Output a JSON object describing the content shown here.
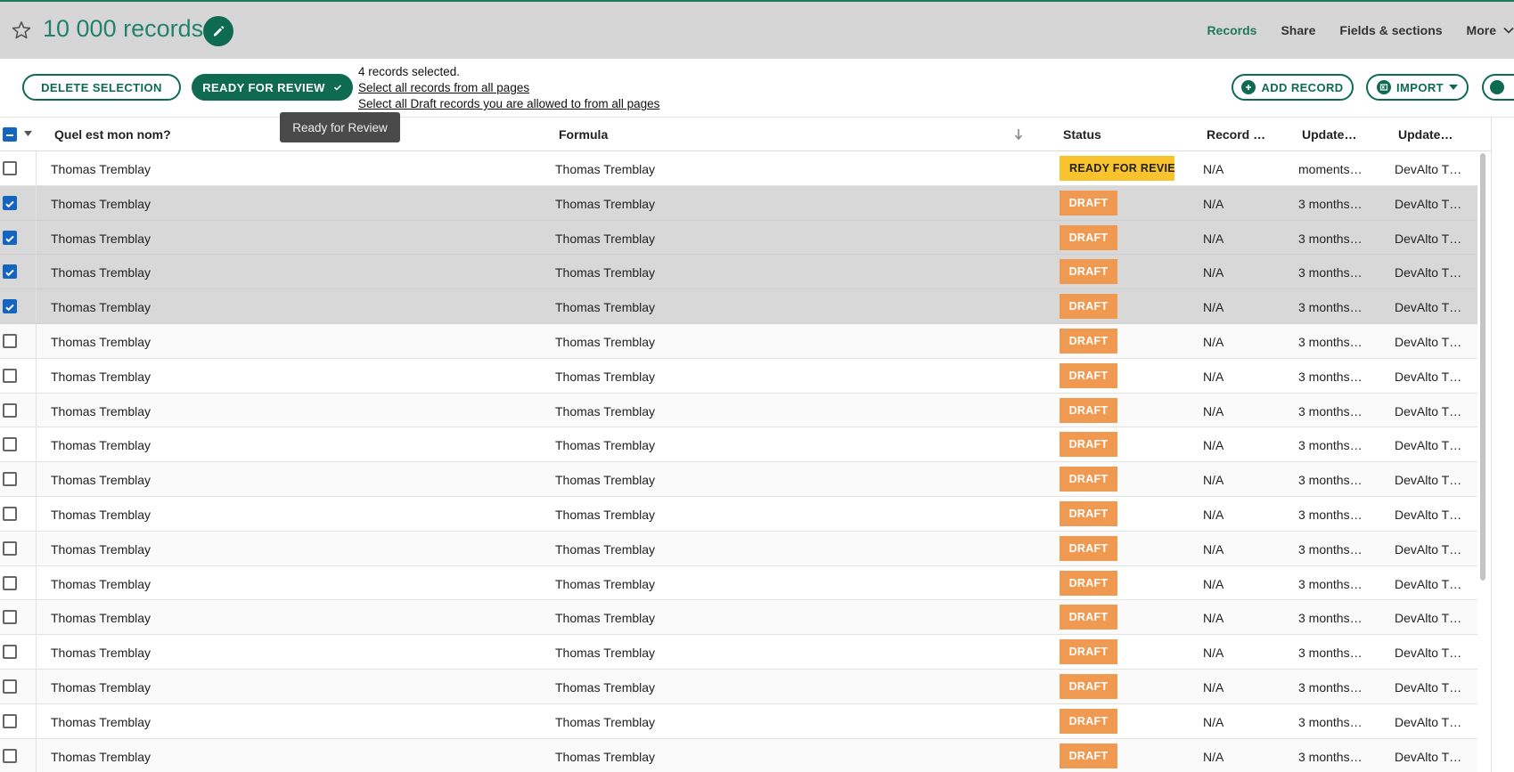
{
  "header": {
    "title": "10 000 records",
    "nav": [
      "Records",
      "Share",
      "Fields & sections",
      "More"
    ],
    "active_nav": "Records"
  },
  "actions": {
    "delete_selection": "DELETE SELECTION",
    "ready_for_review": "READY FOR REVIEW",
    "selection_count": "4 records selected.",
    "select_all_link": "Select all records from all pages",
    "select_draft_link": "Select all Draft records you are allowed to from all pages",
    "add_record": "ADD RECORD",
    "import": "IMPORT",
    "tooltip": "Ready for Review"
  },
  "table": {
    "columns": [
      "Quel est mon nom?",
      "Formula",
      "Status",
      "Record …",
      "Update…",
      "Update…"
    ],
    "rows": [
      {
        "name": "Thomas Tremblay",
        "formula": "Thomas Tremblay",
        "status": "READY FOR REVIEW",
        "record": "N/A",
        "updated": "moments…",
        "updated_by": "DevAlto T…",
        "checked": false
      },
      {
        "name": "Thomas Tremblay",
        "formula": "Thomas Tremblay",
        "status": "DRAFT",
        "record": "N/A",
        "updated": "3 months…",
        "updated_by": "DevAlto T…",
        "checked": true
      },
      {
        "name": "Thomas Tremblay",
        "formula": "Thomas Tremblay",
        "status": "DRAFT",
        "record": "N/A",
        "updated": "3 months…",
        "updated_by": "DevAlto T…",
        "checked": true
      },
      {
        "name": "Thomas Tremblay",
        "formula": "Thomas Tremblay",
        "status": "DRAFT",
        "record": "N/A",
        "updated": "3 months…",
        "updated_by": "DevAlto T…",
        "checked": true
      },
      {
        "name": "Thomas Tremblay",
        "formula": "Thomas Tremblay",
        "status": "DRAFT",
        "record": "N/A",
        "updated": "3 months…",
        "updated_by": "DevAlto T…",
        "checked": true
      },
      {
        "name": "Thomas Tremblay",
        "formula": "Thomas Tremblay",
        "status": "DRAFT",
        "record": "N/A",
        "updated": "3 months…",
        "updated_by": "DevAlto T…",
        "checked": false
      },
      {
        "name": "Thomas Tremblay",
        "formula": "Thomas Tremblay",
        "status": "DRAFT",
        "record": "N/A",
        "updated": "3 months…",
        "updated_by": "DevAlto T…",
        "checked": false
      },
      {
        "name": "Thomas Tremblay",
        "formula": "Thomas Tremblay",
        "status": "DRAFT",
        "record": "N/A",
        "updated": "3 months…",
        "updated_by": "DevAlto T…",
        "checked": false
      },
      {
        "name": "Thomas Tremblay",
        "formula": "Thomas Tremblay",
        "status": "DRAFT",
        "record": "N/A",
        "updated": "3 months…",
        "updated_by": "DevAlto T…",
        "checked": false
      },
      {
        "name": "Thomas Tremblay",
        "formula": "Thomas Tremblay",
        "status": "DRAFT",
        "record": "N/A",
        "updated": "3 months…",
        "updated_by": "DevAlto T…",
        "checked": false
      },
      {
        "name": "Thomas Tremblay",
        "formula": "Thomas Tremblay",
        "status": "DRAFT",
        "record": "N/A",
        "updated": "3 months…",
        "updated_by": "DevAlto T…",
        "checked": false
      },
      {
        "name": "Thomas Tremblay",
        "formula": "Thomas Tremblay",
        "status": "DRAFT",
        "record": "N/A",
        "updated": "3 months…",
        "updated_by": "DevAlto T…",
        "checked": false
      },
      {
        "name": "Thomas Tremblay",
        "formula": "Thomas Tremblay",
        "status": "DRAFT",
        "record": "N/A",
        "updated": "3 months…",
        "updated_by": "DevAlto T…",
        "checked": false
      },
      {
        "name": "Thomas Tremblay",
        "formula": "Thomas Tremblay",
        "status": "DRAFT",
        "record": "N/A",
        "updated": "3 months…",
        "updated_by": "DevAlto T…",
        "checked": false
      },
      {
        "name": "Thomas Tremblay",
        "formula": "Thomas Tremblay",
        "status": "DRAFT",
        "record": "N/A",
        "updated": "3 months…",
        "updated_by": "DevAlto T…",
        "checked": false
      },
      {
        "name": "Thomas Tremblay",
        "formula": "Thomas Tremblay",
        "status": "DRAFT",
        "record": "N/A",
        "updated": "3 months…",
        "updated_by": "DevAlto T…",
        "checked": false
      },
      {
        "name": "Thomas Tremblay",
        "formula": "Thomas Tremblay",
        "status": "DRAFT",
        "record": "N/A",
        "updated": "3 months…",
        "updated_by": "DevAlto T…",
        "checked": false
      },
      {
        "name": "Thomas Tremblay",
        "formula": "Thomas Tremblay",
        "status": "DRAFT",
        "record": "N/A",
        "updated": "3 months…",
        "updated_by": "DevAlto T…",
        "checked": false
      }
    ]
  },
  "colors": {
    "accent": "#0e6b52",
    "title_color": "#23836a",
    "draft": "#ef9a50",
    "review": "#f8c32c",
    "checkbox": "#1565c0",
    "selected_row": "#d8d8d8"
  },
  "icons": [
    "star-icon",
    "pencil-icon",
    "chevron-down-icon",
    "plus-circle-icon",
    "excel-icon",
    "check-icon",
    "sort-down-icon",
    "checkbox-indeterminate-icon"
  ]
}
